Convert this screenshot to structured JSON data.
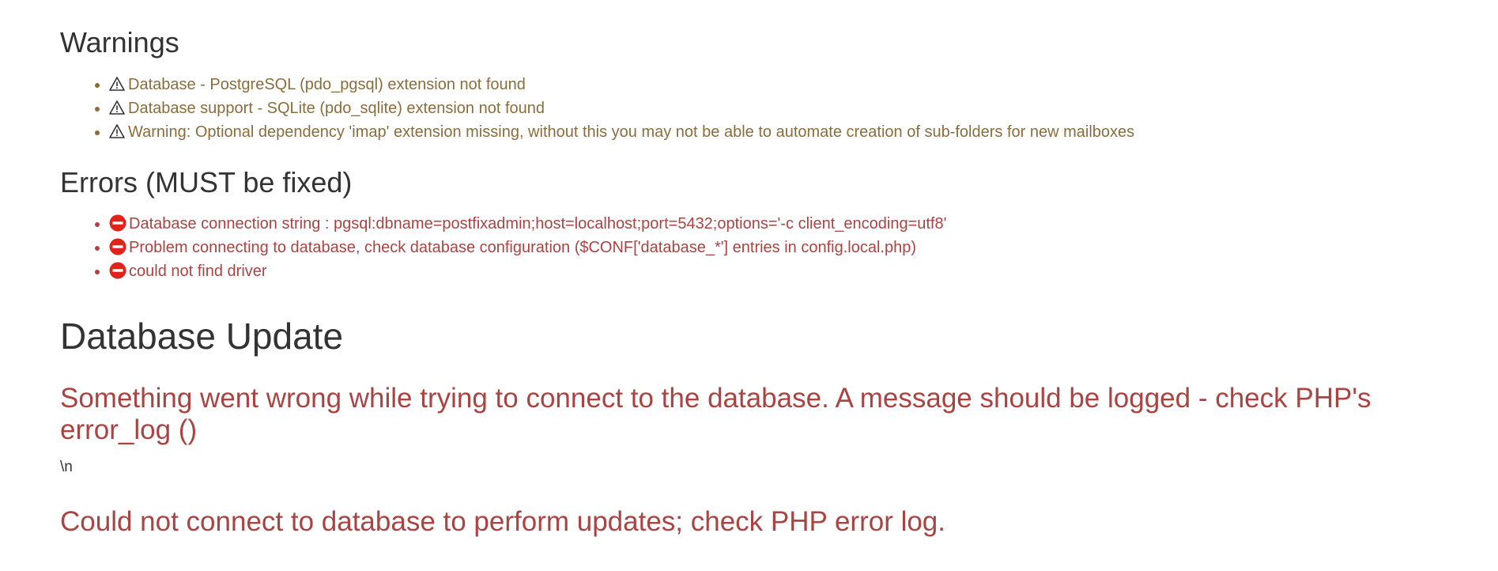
{
  "warnings_section": {
    "heading": "Warnings",
    "items": [
      "Database - PostgreSQL (pdo_pgsql) extension not found",
      "Database support - SQLite (pdo_sqlite) extension not found",
      "Warning: Optional dependency 'imap' extension missing, without this you may not be able to automate creation of sub-folders for new mailboxes"
    ],
    "icon": "warning-triangle-icon",
    "color": "#8a6d3b"
  },
  "errors_section": {
    "heading": "Errors (MUST be fixed)",
    "items": [
      "Database connection string : pgsql:dbname=postfixadmin;host=localhost;port=5432;options='-c client_encoding=utf8'",
      "Problem connecting to database, check database configuration ($CONF['database_*'] entries in config.local.php)",
      "could not find driver"
    ],
    "icon": "no-entry-icon",
    "color": "#a94442"
  },
  "database_update": {
    "title": "Database Update",
    "error_message": "Something went wrong while trying to connect to the database. A message should be logged - check PHP's error_log ()",
    "newline_text": "\\n",
    "final_error": "Could not connect to database to perform updates; check PHP error log."
  }
}
